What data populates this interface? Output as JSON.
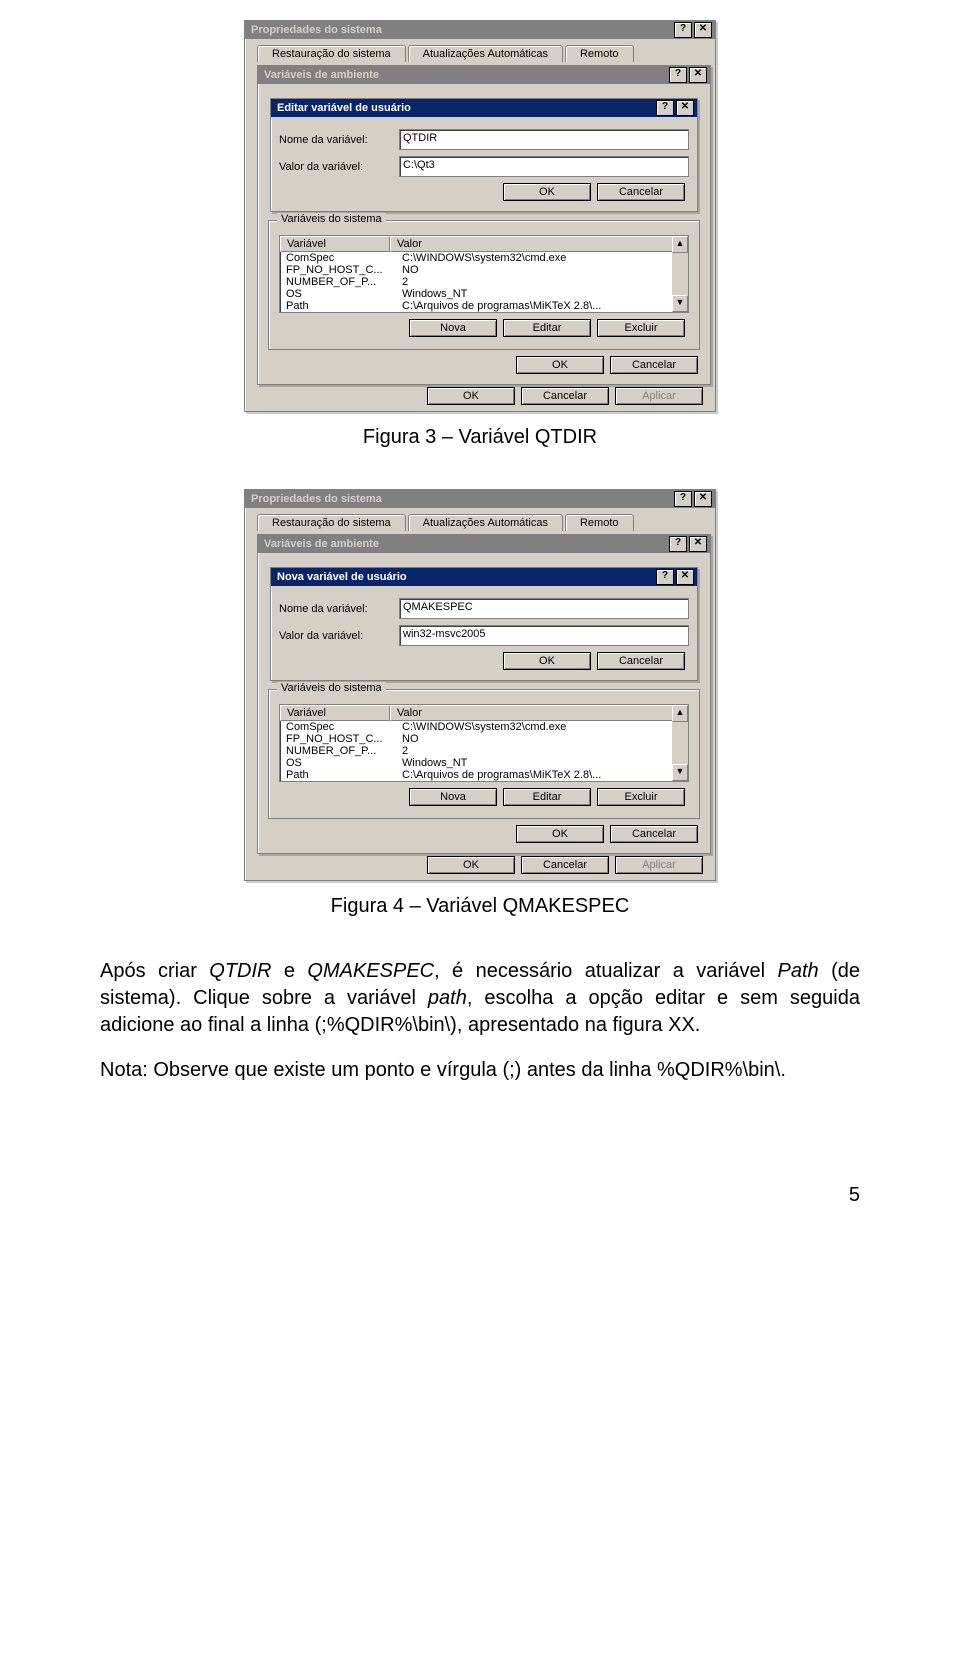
{
  "captions": {
    "fig3": "Figura 3 – Variável QTDIR",
    "fig4": "Figura 4 – Variável QMAKESPEC"
  },
  "paragraph1_a": "Após criar ",
  "paragraph1_qtdir": "QTDIR",
  "paragraph1_b": " e ",
  "paragraph1_qmakespec": "QMAKESPEC",
  "paragraph1_c": ", é necessário atualizar a variável ",
  "paragraph1_path": "Path",
  "paragraph1_d": " (de sistema). Clique sobre a variável ",
  "paragraph1_pathvar": "path",
  "paragraph1_e": ", escolha a opção editar e sem seguida adicione ao final a linha (;%QDIR%\\bin\\), apresentado na figura XX.",
  "paragraph2": "Nota: Observe que existe um ponto e vírgula (;) antes da linha %QDIR%\\bin\\.",
  "page_number": "5",
  "common": {
    "sys_title": "Propriedades do sistema",
    "env_title": "Variáveis de ambiente",
    "tab_restore": "Restauração do sistema",
    "tab_updates": "Atualizações Automáticas",
    "tab_remote": "Remoto",
    "label_name": "Nome da variável:",
    "label_value": "Valor da variável:",
    "btn_ok": "OK",
    "btn_cancel": "Cancelar",
    "btn_apply": "Aplicar",
    "btn_new": "Nova",
    "btn_edit": "Editar",
    "btn_delete": "Excluir",
    "group_sysvars": "Variáveis do sistema",
    "col_var": "Variável",
    "col_val": "Valor",
    "help_glyph": "?",
    "close_glyph": "✕",
    "up_glyph": "▲",
    "down_glyph": "▼"
  },
  "fig3": {
    "inner_title": "Editar variável de usuário",
    "field_name": "QTDIR",
    "field_value": "C:\\Qt3"
  },
  "fig4": {
    "inner_title": "Nova variável de usuário",
    "field_name": "QMAKESPEC",
    "field_value": "win32-msvc2005"
  },
  "sysvars": [
    {
      "var": "ComSpec",
      "val": "C:\\WINDOWS\\system32\\cmd.exe"
    },
    {
      "var": "FP_NO_HOST_C...",
      "val": "NO"
    },
    {
      "var": "NUMBER_OF_P...",
      "val": "2"
    },
    {
      "var": "OS",
      "val": "Windows_NT"
    },
    {
      "var": "Path",
      "val": "C:\\Arquivos de programas\\MiKTeX 2.8\\..."
    }
  ]
}
